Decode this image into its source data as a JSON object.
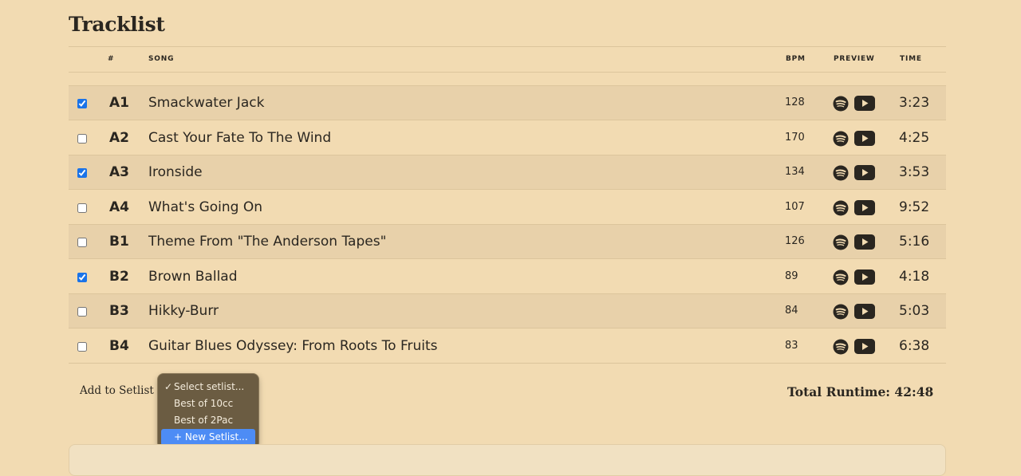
{
  "title": "Tracklist",
  "columns": {
    "number": "#",
    "song": "SONG",
    "bpm": "BPM",
    "preview": "PREVIEW",
    "time": "TIME"
  },
  "tracks": [
    {
      "number": "A1",
      "song": "Smackwater Jack",
      "bpm": "128",
      "time": "3:23",
      "checked": true
    },
    {
      "number": "A2",
      "song": "Cast Your Fate To The Wind",
      "bpm": "170",
      "time": "4:25",
      "checked": false
    },
    {
      "number": "A3",
      "song": "Ironside",
      "bpm": "134",
      "time": "3:53",
      "checked": true
    },
    {
      "number": "A4",
      "song": "What's Going On",
      "bpm": "107",
      "time": "9:52",
      "checked": false
    },
    {
      "number": "B1",
      "song": "Theme From \"The Anderson Tapes\"",
      "bpm": "126",
      "time": "5:16",
      "checked": false
    },
    {
      "number": "B2",
      "song": "Brown Ballad",
      "bpm": "89",
      "time": "4:18",
      "checked": true
    },
    {
      "number": "B3",
      "song": "Hikky-Burr",
      "bpm": "84",
      "time": "5:03",
      "checked": false
    },
    {
      "number": "B4",
      "song": "Guitar Blues Odyssey: From Roots To Fruits",
      "bpm": "83",
      "time": "6:38",
      "checked": false
    }
  ],
  "preview_icons": [
    "spotify-icon",
    "youtube-icon"
  ],
  "setlist": {
    "label": "Add to Setlist",
    "options": [
      {
        "label": "Select setlist...",
        "selected": true
      },
      {
        "label": "Best of 10cc"
      },
      {
        "label": "Best of 2Pac"
      },
      {
        "label": "+ New Setlist...",
        "highlighted": true
      }
    ]
  },
  "total_runtime": "Total Runtime: 42:48",
  "colors": {
    "background": "#f2dbb2",
    "row_shaded": "#e8d1aa",
    "checkbox": "#1a73e8",
    "dropdown_bg": "#6b5c42",
    "dropdown_highlight": "#4d8cf5"
  }
}
